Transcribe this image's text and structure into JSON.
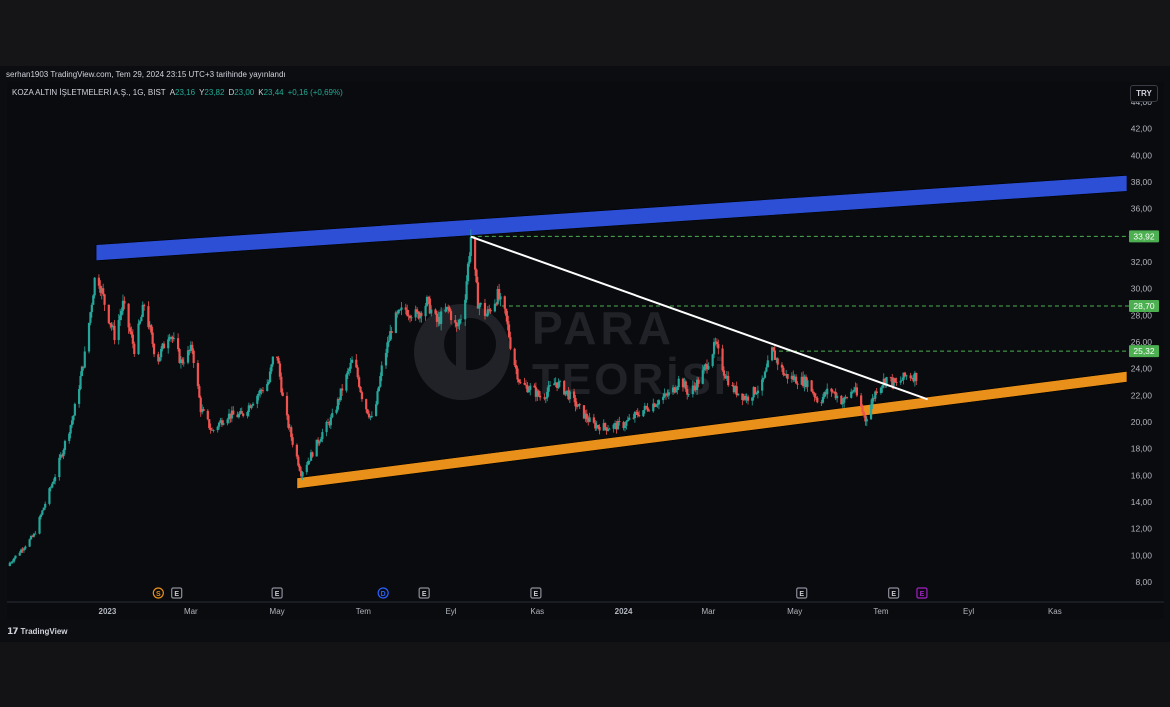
{
  "publish_info": "serhan1903 TradingView.com, Tem 29, 2024 23:15 UTC+3 tarihinde yayınlandı",
  "legend": {
    "symbol": "KOZA ALTIN İŞLETMELERİ A.Ş., 1G, BIST",
    "open_label": "A",
    "open": "23,16",
    "high_label": "Y",
    "high": "23,82",
    "low_label": "D",
    "low": "23,00",
    "close_label": "K",
    "close": "23,44",
    "change": "+0,16 (+0,69%)"
  },
  "currency": "TRY",
  "branding": "TradingView",
  "watermark": {
    "line1": "PARA",
    "line2": "TEORİSİ"
  },
  "colors": {
    "up": "#26a69a",
    "down": "#ef5350",
    "resistance_band": "#2c4fd6",
    "support_band": "#e8901a",
    "trendline": "#ffffff",
    "level_line": "#4caf50",
    "level_label_bg": "#4caf50"
  },
  "chart_data": {
    "type": "candlestick",
    "symbol": "KOZA ALTIN İŞLETMELERİ A.Ş.",
    "interval": "1G",
    "exchange": "BIST",
    "currency": "TRY",
    "ylim": [
      6.5,
      45.5
    ],
    "y_ticks": [
      "8,00",
      "10,00",
      "12,00",
      "14,00",
      "16,00",
      "18,00",
      "20,00",
      "22,00",
      "24,00",
      "26,00",
      "28,00",
      "30,00",
      "32,00",
      "34,00",
      "36,00",
      "38,00",
      "40,00",
      "42,00",
      "44,00"
    ],
    "x_ticks": [
      {
        "label": "2023",
        "date": "2023-01-01",
        "bold": true
      },
      {
        "label": "Mar",
        "date": "2023-03-01",
        "bold": false
      },
      {
        "label": "May",
        "date": "2023-05-01",
        "bold": false
      },
      {
        "label": "Tem",
        "date": "2023-07-01",
        "bold": false
      },
      {
        "label": "Eyl",
        "date": "2023-09-01",
        "bold": false
      },
      {
        "label": "Kas",
        "date": "2023-11-01",
        "bold": false
      },
      {
        "label": "2024",
        "date": "2024-01-01",
        "bold": true
      },
      {
        "label": "Mar",
        "date": "2024-03-01",
        "bold": false
      },
      {
        "label": "May",
        "date": "2024-05-01",
        "bold": false
      },
      {
        "label": "Tem",
        "date": "2024-07-01",
        "bold": false
      },
      {
        "label": "Eyl",
        "date": "2024-09-01",
        "bold": false
      },
      {
        "label": "Kas",
        "date": "2024-11-01",
        "bold": false
      }
    ],
    "x_range": [
      "2022-10-22",
      "2024-12-22"
    ],
    "price_path": [
      [
        "2022-10-22",
        9.2
      ],
      [
        "2022-11-10",
        11.5
      ],
      [
        "2022-11-25",
        16
      ],
      [
        "2022-12-08",
        20.5
      ],
      [
        "2022-12-16",
        25
      ],
      [
        "2022-12-24",
        31.5
      ],
      [
        "2022-12-31",
        28.5
      ],
      [
        "2023-01-06",
        26.5
      ],
      [
        "2023-01-12",
        28.8
      ],
      [
        "2023-01-20",
        25.5
      ],
      [
        "2023-01-27",
        28.8
      ],
      [
        "2023-02-05",
        24.5
      ],
      [
        "2023-02-14",
        26.8
      ],
      [
        "2023-02-22",
        24.5
      ],
      [
        "2023-03-02",
        25.5
      ],
      [
        "2023-03-08",
        21
      ],
      [
        "2023-03-16",
        19.3
      ],
      [
        "2023-03-26",
        20.5
      ],
      [
        "2023-04-06",
        20.5
      ],
      [
        "2023-04-15",
        21.8
      ],
      [
        "2023-04-25",
        23
      ],
      [
        "2023-04-30",
        25.8
      ],
      [
        "2023-05-06",
        21
      ],
      [
        "2023-05-12",
        18.5
      ],
      [
        "2023-05-18",
        16.2
      ],
      [
        "2023-05-25",
        17.5
      ],
      [
        "2023-06-02",
        19.2
      ],
      [
        "2023-06-10",
        20.5
      ],
      [
        "2023-06-16",
        22.5
      ],
      [
        "2023-06-24",
        24.8
      ],
      [
        "2023-07-01",
        21.5
      ],
      [
        "2023-07-08",
        20
      ],
      [
        "2023-07-14",
        24
      ],
      [
        "2023-07-22",
        27.5
      ],
      [
        "2023-07-30",
        28.5
      ],
      [
        "2023-08-08",
        28
      ],
      [
        "2023-08-15",
        29
      ],
      [
        "2023-08-22",
        27.5
      ],
      [
        "2023-08-30",
        28.5
      ],
      [
        "2023-09-05",
        27
      ],
      [
        "2023-09-10",
        28.5
      ],
      [
        "2023-09-15",
        33.9
      ],
      [
        "2023-09-20",
        29
      ],
      [
        "2023-09-26",
        28
      ],
      [
        "2023-10-04",
        29.5
      ],
      [
        "2023-10-10",
        27.8
      ],
      [
        "2023-10-14",
        25.2
      ],
      [
        "2023-10-20",
        22.8
      ],
      [
        "2023-10-28",
        22.5
      ],
      [
        "2023-11-04",
        21.8
      ],
      [
        "2023-11-14",
        23
      ],
      [
        "2023-11-22",
        22.2
      ],
      [
        "2023-12-02",
        20.8
      ],
      [
        "2023-12-10",
        19.8
      ],
      [
        "2023-12-20",
        19.6
      ],
      [
        "2024-01-01",
        19.8
      ],
      [
        "2024-01-12",
        20.7
      ],
      [
        "2024-01-24",
        21.5
      ],
      [
        "2024-02-04",
        22.2
      ],
      [
        "2024-02-10",
        23.3
      ],
      [
        "2024-02-16",
        22.1
      ],
      [
        "2024-02-24",
        23.2
      ],
      [
        "2024-03-01",
        24.6
      ],
      [
        "2024-03-06",
        25.8
      ],
      [
        "2024-03-12",
        23.8
      ],
      [
        "2024-03-18",
        22.5
      ],
      [
        "2024-03-28",
        21.8
      ],
      [
        "2024-04-08",
        22.8
      ],
      [
        "2024-04-15",
        25.3
      ],
      [
        "2024-04-24",
        23.5
      ],
      [
        "2024-05-02",
        23.2
      ],
      [
        "2024-05-10",
        23
      ],
      [
        "2024-05-18",
        21.5
      ],
      [
        "2024-05-26",
        22.5
      ],
      [
        "2024-06-04",
        21.5
      ],
      [
        "2024-06-12",
        22.5
      ],
      [
        "2024-06-20",
        20.2
      ],
      [
        "2024-06-28",
        22.5
      ],
      [
        "2024-07-05",
        23.3
      ],
      [
        "2024-07-12",
        22.8
      ],
      [
        "2024-07-19",
        23.5
      ],
      [
        "2024-07-26",
        23.44
      ]
    ],
    "resistance_band": {
      "start": [
        "2022-12-24",
        32.7
      ],
      "end": [
        "2024-12-22",
        37.9
      ],
      "thickness": 1.2
    },
    "support_band": {
      "start": [
        "2023-05-15",
        15.4
      ],
      "end": [
        "2024-12-22",
        23.4
      ],
      "thickness": 0.8
    },
    "trendline": {
      "start": [
        "2023-09-15",
        33.9
      ],
      "end": [
        "2024-08-03",
        21.7
      ]
    },
    "levels": [
      {
        "value": 33.92,
        "label": "33,92",
        "from": "2023-09-15"
      },
      {
        "value": 28.7,
        "label": "28,70",
        "from": "2023-10-07"
      },
      {
        "value": 25.32,
        "label": "25,32",
        "from": "2024-04-15"
      }
    ],
    "events": [
      {
        "date": "2023-02-06",
        "letter": "S",
        "color": "#e8901a"
      },
      {
        "date": "2023-02-19",
        "letter": "E",
        "color": "#8a8e99"
      },
      {
        "date": "2023-05-01",
        "letter": "E",
        "color": "#8a8e99"
      },
      {
        "date": "2023-07-15",
        "letter": "D",
        "color": "#2962ff"
      },
      {
        "date": "2023-08-13",
        "letter": "E",
        "color": "#8a8e99"
      },
      {
        "date": "2023-10-31",
        "letter": "E",
        "color": "#8a8e99"
      },
      {
        "date": "2024-05-06",
        "letter": "E",
        "color": "#8a8e99"
      },
      {
        "date": "2024-07-10",
        "letter": "E",
        "color": "#8a8e99"
      },
      {
        "date": "2024-07-30",
        "letter": "E",
        "color": "#a020c0"
      }
    ]
  }
}
